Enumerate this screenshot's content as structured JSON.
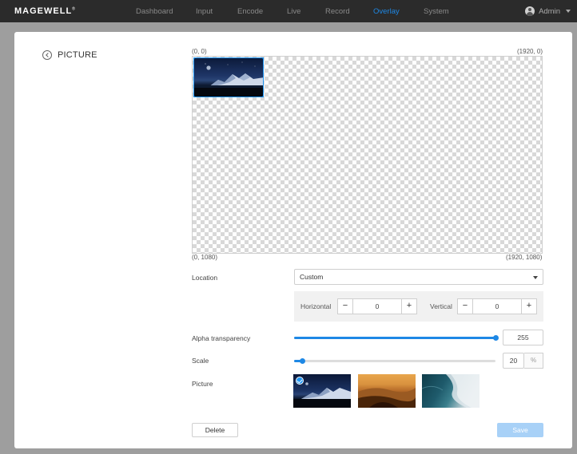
{
  "brand": {
    "logo_text": "MAGEWELL",
    "logo_mark": "®"
  },
  "nav": {
    "items": [
      {
        "label": "Dashboard"
      },
      {
        "label": "Input"
      },
      {
        "label": "Encode"
      },
      {
        "label": "Live"
      },
      {
        "label": "Record"
      },
      {
        "label": "Overlay",
        "active": true
      },
      {
        "label": "System"
      }
    ],
    "user": "Admin"
  },
  "page": {
    "title": "PICTURE"
  },
  "canvas": {
    "top_left": "(0, 0)",
    "top_right": "(1920, 0)",
    "bottom_left": "(0, 1080)",
    "bottom_right": "(1920, 1080)"
  },
  "location": {
    "label": "Location",
    "value": "Custom"
  },
  "position": {
    "horizontal_label": "Horizontal",
    "horizontal_value": "0",
    "vertical_label": "Vertical",
    "vertical_value": "0",
    "minus": "−",
    "plus": "+"
  },
  "alpha": {
    "label": "Alpha transparency",
    "value": "255",
    "fraction": 1.0
  },
  "scale": {
    "label": "Scale",
    "value": "20",
    "unit": "%",
    "fraction": 0.04
  },
  "picture": {
    "label": "Picture",
    "selected_index": 0
  },
  "buttons": {
    "delete": "Delete",
    "save": "Save"
  },
  "colors": {
    "accent": "#1e88e5",
    "nav_bg": "#2b2b2b",
    "save_disabled": "#a8d1f7"
  }
}
